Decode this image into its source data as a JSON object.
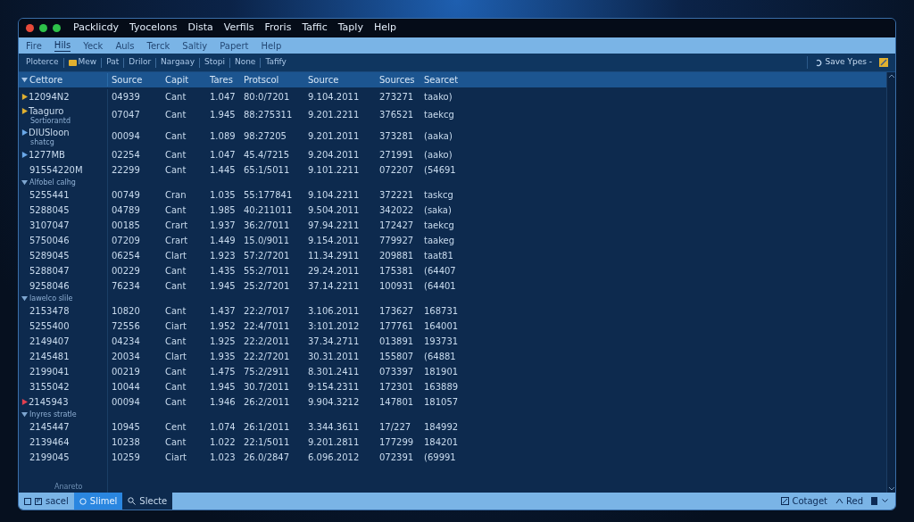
{
  "title_menu": [
    "Packlicdy",
    "Tyocelons",
    "Dista",
    "Verfils",
    "Froris",
    "Taffic",
    "Taply",
    "Help"
  ],
  "menu": [
    {
      "label": "Fire",
      "selected": false
    },
    {
      "label": "Hils",
      "selected": true
    },
    {
      "label": "Yeck",
      "selected": false
    },
    {
      "label": "Auls",
      "selected": false
    },
    {
      "label": "Terck",
      "selected": false
    },
    {
      "label": "Saltiy",
      "selected": false
    },
    {
      "label": "Papert",
      "selected": false
    },
    {
      "label": "Help",
      "selected": false
    }
  ],
  "toolbar": {
    "items": [
      {
        "label": "Ploterce",
        "kind": "text"
      },
      {
        "label": "Mew",
        "kind": "icon"
      },
      {
        "label": "Pat",
        "kind": "text"
      },
      {
        "label": "Drilor",
        "kind": "text"
      },
      {
        "label": "Nargaay",
        "kind": "text"
      },
      {
        "label": "Stopi",
        "kind": "text"
      },
      {
        "label": "None",
        "kind": "text"
      },
      {
        "label": "Tafify",
        "kind": "text"
      }
    ],
    "save": "Save Ypes -"
  },
  "table": {
    "columns": [
      "Cettore",
      "Source",
      "Capit",
      "Tares",
      "Protscol",
      "Source",
      "Sources",
      "Searcet"
    ],
    "rows": [
      {
        "kind": "row",
        "color": "#e0b030",
        "cells": [
          "12094N2",
          "04939",
          "Cant",
          "1.047",
          "80:0/7201",
          "9.104.2011",
          "273271",
          "taako)"
        ]
      },
      {
        "kind": "row",
        "color": "#e0b030",
        "sub": "Sortiorantd",
        "cells": [
          "Taaguro",
          "07047",
          "Cant",
          "1.945",
          "88:275311",
          "9.201.2211",
          "376521",
          "taekcg"
        ]
      },
      {
        "kind": "row",
        "color": "#6aa8e8",
        "sub": "shatcg",
        "cells": [
          "DIUSloon",
          "00094",
          "Cant",
          "1.089",
          "98:27205",
          "9.201.2011",
          "373281",
          "(aaka)"
        ]
      },
      {
        "kind": "row",
        "color": "#6aa8e8",
        "cells": [
          "1277MB",
          "02254",
          "Cant",
          "1.047",
          "45.4/7215",
          "9.204.2011",
          "271991",
          "(aako)"
        ]
      },
      {
        "kind": "row",
        "cells": [
          "91554220M",
          "22299",
          "Cant",
          "1.445",
          "65:1/5011",
          "9.101.2211",
          "072207",
          "(54691"
        ]
      },
      {
        "kind": "group",
        "label": "Alfobel calhg"
      },
      {
        "kind": "row",
        "cells": [
          "5255441",
          "00749",
          "Cran",
          "1.035",
          "55:177841",
          "9.104.2211",
          "372221",
          "taskcg"
        ]
      },
      {
        "kind": "row",
        "cells": [
          "5288045",
          "04789",
          "Cant",
          "1.985",
          "40:211011",
          "9.504.2011",
          "342022",
          "(saka)"
        ]
      },
      {
        "kind": "row",
        "cells": [
          "3107047",
          "00185",
          "Crart",
          "1.937",
          "36:2/7011",
          "97.94.2211",
          "172427",
          "taekcg"
        ]
      },
      {
        "kind": "row",
        "cells": [
          "5750046",
          "07209",
          "Crart",
          "1.449",
          "15.0/9011",
          "9.154.2011",
          "779927",
          "taakeg"
        ]
      },
      {
        "kind": "row",
        "cells": [
          "5289045",
          "06254",
          "Clart",
          "1.923",
          "57:2/7201",
          "11.34.2911",
          "209881",
          "taat81"
        ]
      },
      {
        "kind": "row",
        "cells": [
          "5288047",
          "00229",
          "Cant",
          "1.435",
          "55:2/7011",
          "29.24.2011",
          "175381",
          "(64407"
        ]
      },
      {
        "kind": "row",
        "cells": [
          "9258046",
          "76234",
          "Cant",
          "1.945",
          "25:2/7201",
          "37.14.2211",
          "100931",
          "(64401"
        ]
      },
      {
        "kind": "group",
        "label": "lawelco slile"
      },
      {
        "kind": "row",
        "cells": [
          "2153478",
          "10820",
          "Cant",
          "1.437",
          "22:2/7017",
          "3.106.2011",
          "173627",
          "168731"
        ]
      },
      {
        "kind": "row",
        "cells": [
          "5255400",
          "72556",
          "Ciart",
          "1.952",
          "22:4/7011",
          "3:101.2012",
          "177761",
          "164001"
        ]
      },
      {
        "kind": "row",
        "cells": [
          "2149407",
          "04234",
          "Cant",
          "1.925",
          "22:2/2011",
          "37.34.2711",
          "013891",
          "193731"
        ]
      },
      {
        "kind": "row",
        "cells": [
          "2145481",
          "20034",
          "Clart",
          "1.935",
          "22:2/7201",
          "30.31.2011",
          "155807",
          "(64881"
        ]
      },
      {
        "kind": "row",
        "cells": [
          "2199041",
          "00219",
          "Cant",
          "1.475",
          "75:2/2911",
          "8.301.2411",
          "073397",
          "181901"
        ]
      },
      {
        "kind": "row",
        "cells": [
          "3155042",
          "10044",
          "Cant",
          "1.945",
          "30.7/2011",
          "9:154.2311",
          "172301",
          "163889"
        ]
      },
      {
        "kind": "row",
        "color": "#e04050",
        "cells": [
          "2145943",
          "00094",
          "Cant",
          "1.946",
          "26:2/2011",
          "9.904.3212",
          "147801",
          "181057"
        ]
      },
      {
        "kind": "group",
        "label": "Inyres stratle"
      },
      {
        "kind": "row",
        "cells": [
          "2145447",
          "10945",
          "Cent",
          "1.074",
          "26:1/2011",
          "3.344.3611",
          "17/227",
          "184992"
        ]
      },
      {
        "kind": "row",
        "cells": [
          "2139464",
          "10238",
          "Cant",
          "1.022",
          "22:1/5011",
          "9.201.2811",
          "177299",
          "184201"
        ]
      },
      {
        "kind": "row",
        "cells": [
          "2199045",
          "10259",
          "Ciart",
          "1.023",
          "26.0/2847",
          "6.096.2012",
          "072391",
          "(69991"
        ]
      }
    ],
    "footer": "Anareto"
  },
  "status_tabs": [
    {
      "label": "sacel",
      "selected": false
    },
    {
      "label": "Slimel",
      "selected": true
    },
    {
      "label": "Slecte",
      "selected": false
    }
  ],
  "status_right": [
    "Cotaget",
    "Red"
  ]
}
